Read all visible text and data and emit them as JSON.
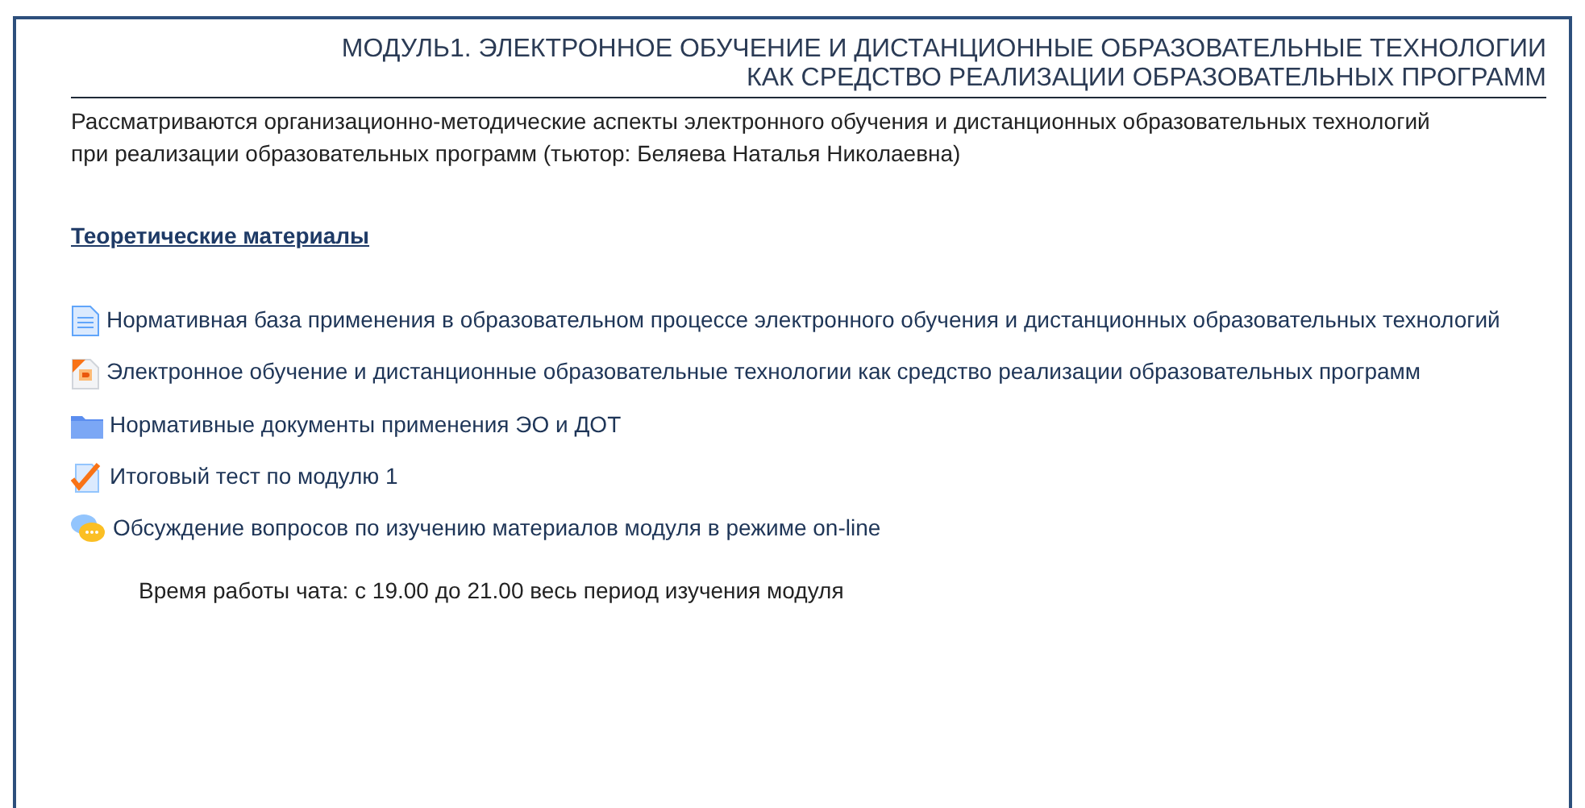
{
  "section": {
    "title_lines": [
      "МОДУЛЬ1. ЭЛЕКТРОННОЕ ОБУЧЕНИЕ И ДИСТАНЦИОННЫЕ ОБРАЗОВАТЕЛЬНЫЕ ТЕХНОЛОГИИ",
      "КАК СРЕДСТВО РЕАЛИЗАЦИИ ОБРАЗОВАТЕЛЬНЫХ ПРОГРАММ"
    ],
    "description": "Рассматриваются организационно-методические аспекты электронного обучения и дистанционных образовательных технологий при реализации образовательных программ (тьютор: Беляева Наталья Николаевна)",
    "heading": "Теоретические материалы",
    "items": [
      {
        "kind": "page",
        "label": "Нормативная база применения в образовательном процессе электронного обучения и дистанционных образовательных технологий"
      },
      {
        "kind": "presentation",
        "label": "Электронное обучение и дистанционные образовательные технологии как средство реализации образовательных программ"
      },
      {
        "kind": "folder",
        "label": "Нормативные документы применения ЭО и ДОТ"
      },
      {
        "kind": "quiz",
        "label": "Итоговый тест по модулю 1"
      },
      {
        "kind": "chat",
        "label": "Обсуждение вопросов по изучению материалов модуля в режиме on-line"
      }
    ],
    "note": "Время работы чата: с 19.00 до 21.00 весь период изучения модуля"
  }
}
